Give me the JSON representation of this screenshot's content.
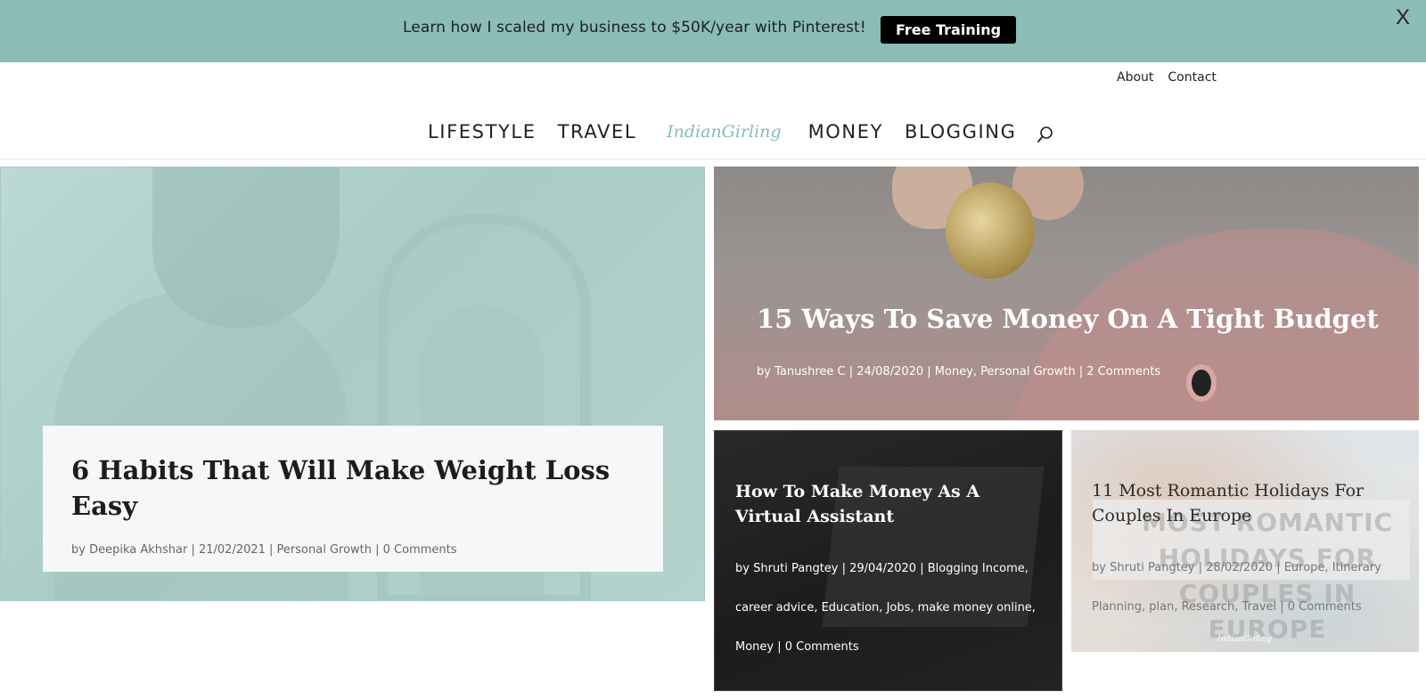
{
  "promo": {
    "text": "Learn how I scaled my business to $50K/year with Pinterest!",
    "button_label": "Free Training",
    "close_label": "X"
  },
  "header": {
    "top_links": [
      "About",
      "Contact"
    ],
    "nav": {
      "lifestyle": "LIFESTYLE",
      "travel": "TRAVEL",
      "logo": "IndianGirling",
      "money": "MONEY",
      "blogging": "BLOGGING"
    },
    "search_icon": "search-icon"
  },
  "posts": [
    {
      "title": "6 Habits That Will Make Weight Loss Easy",
      "meta": "by Deepika Akhshar | 21/02/2021 | Personal Growth | 0 Comments"
    },
    {
      "title": "15 Ways To Save Money On A Tight Budget",
      "meta": "by Tanushree C | 24/08/2020 | Money, Personal Growth | 2 Comments"
    },
    {
      "title": "How To Make Money As A Virtual Assistant",
      "meta": "by Shruti Pangtey | 29/04/2020 | Blogging Income, career advice, Education, Jobs, make money online, Money | 0 Comments"
    },
    {
      "title": "11 Most Romantic Holidays For Couples In Europe",
      "meta": "by Shruti Pangtey | 28/02/2020 | Europe, Itinerary Planning, plan, Research, Travel | 0 Comments",
      "image_overlay_text": "MOST ROMANTIC HOLIDAYS FOR COUPLES IN EUROPE",
      "image_brand": "IndianGirling"
    }
  ],
  "colors": {
    "promo_bg": "#8bbcb8",
    "logo": "#86bcb7",
    "promo_button": "#000000"
  }
}
